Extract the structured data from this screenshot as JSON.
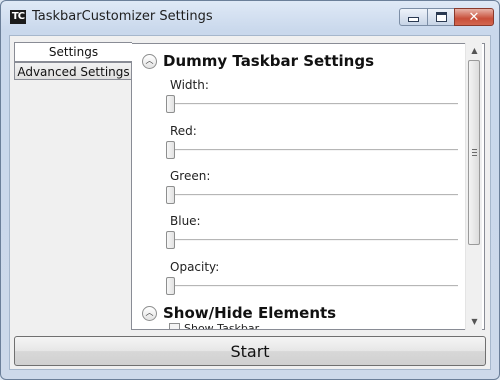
{
  "window": {
    "title": "TaskbarCustomizer Settings",
    "app_icon_text": "TC",
    "minimize_icon": "minimize-icon",
    "maximize_icon": "maximize-icon",
    "close_icon": "close-icon"
  },
  "tabs": [
    {
      "label": "Settings",
      "selected": true
    },
    {
      "label": "Advanced Settings",
      "selected": false
    }
  ],
  "sections": [
    {
      "title": "Dummy Taskbar Settings",
      "collapse_icon": "chevron-up-icon"
    },
    {
      "title": "Show/Hide Elements",
      "collapse_icon": "chevron-up-icon"
    }
  ],
  "sliders": [
    {
      "label": "Width:",
      "value": 0
    },
    {
      "label": "Red:",
      "value": 0
    },
    {
      "label": "Green:",
      "value": 0
    },
    {
      "label": "Blue:",
      "value": 0
    },
    {
      "label": "Opacity:",
      "value": 0
    }
  ],
  "checkbox": {
    "label": "Show Taskbar",
    "checked": false
  },
  "start_button": {
    "label": "Start"
  },
  "colors": {
    "title_bar": "#c9d8ec",
    "close_button": "#c84f39",
    "panel": "#ffffff"
  }
}
